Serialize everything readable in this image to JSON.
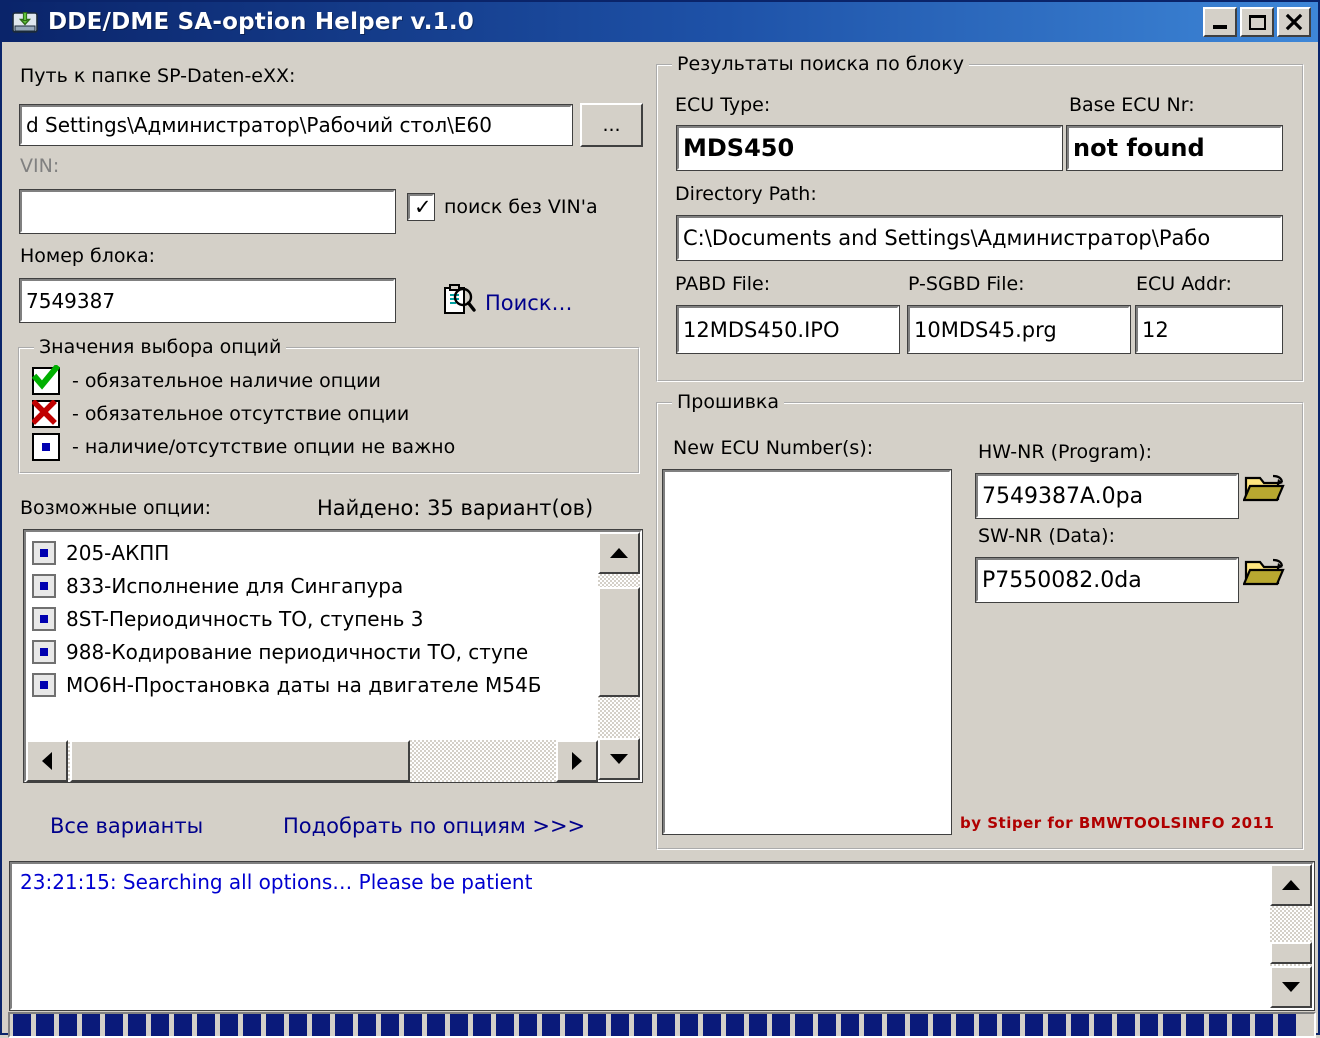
{
  "window": {
    "title": "DDE/DME SA-option Helper  v.1.0",
    "icon": "disk-download-icon",
    "minimize_label": "_",
    "maximize_label": "□",
    "close_label": "✕",
    "accent_color": "#0a246a",
    "face_color": "#d4d0c8"
  },
  "left": {
    "path_label": "Путь к папке SP-Daten-eXX:",
    "path_value": "d Settings\\Администратор\\Рабочий стол\\E60",
    "browse_label": "...",
    "vin_label": "VIN:",
    "vin_value": "",
    "search_without_vin_label": "поиск без VIN'a",
    "search_without_vin_checked": true,
    "block_number_label": "Номер блока:",
    "block_number_value": "7549387",
    "search_button_label": "Поиск…",
    "search_icon": "magnifier-clipboard-icon"
  },
  "legend": {
    "title": "Значения выбора опций",
    "items": [
      {
        "icon": "green-check-icon",
        "text": "- обязательное наличие опции"
      },
      {
        "icon": "red-cross-icon",
        "text": "- обязательное отсутствие опции"
      },
      {
        "icon": "blue-square-icon",
        "text": "- наличие/отсутствие опции не важно"
      }
    ]
  },
  "options": {
    "label": "Возможные опции:",
    "found_label": "Найдено: 35 вариант(ов)",
    "items": [
      {
        "text": "205-АКПП"
      },
      {
        "text": "833-Исполнение для Сингапура"
      },
      {
        "text": "8ST-Периодичность ТО, ступень 3"
      },
      {
        "text": "988-Кодирование периодичности ТО, ступе"
      },
      {
        "text": "MO6H-Простановка даты на двигателе M54Б"
      }
    ]
  },
  "actions": {
    "all_variants_label": "Все варианты",
    "match_by_options_label": "Подобрать по опциям >>>"
  },
  "results": {
    "title": "Результаты поиска по блоку",
    "ecu_type_label": "ECU Type:",
    "ecu_type_value": "MDS450",
    "base_ecu_nr_label": "Base ECU Nr:",
    "base_ecu_nr_value": "not found",
    "directory_path_label": "Directory Path:",
    "directory_path_value": "C:\\Documents and Settings\\Администратор\\Рабо",
    "pabd_file_label": "PABD File:",
    "pabd_file_value": "12MDS450.IPO",
    "psgbd_file_label": "P-SGBD File:",
    "psgbd_file_value": "10MDS45.prg",
    "ecu_addr_label": "ECU Addr:",
    "ecu_addr_value": "12"
  },
  "firmware": {
    "title": "Прошивка",
    "new_ecu_numbers_label": "New ECU Number(s):",
    "new_ecu_numbers_value": "",
    "hw_nr_label": "HW-NR (Program):",
    "hw_nr_value": "7549387A.0pa",
    "sw_nr_label": "SW-NR (Data):",
    "sw_nr_value": "P7550082.0da",
    "browse_icon": "open-folder-icon",
    "signature": "by Stiper for BMWTOOLSINFO 2011",
    "signature_color": "#b00000"
  },
  "log": {
    "lines": [
      "23:21:15:  Searching all options… Please be patient"
    ],
    "text_color": "#0000d0"
  },
  "statusbar": {
    "progress_blocks": 44,
    "block_color": "#0a1a7a"
  }
}
